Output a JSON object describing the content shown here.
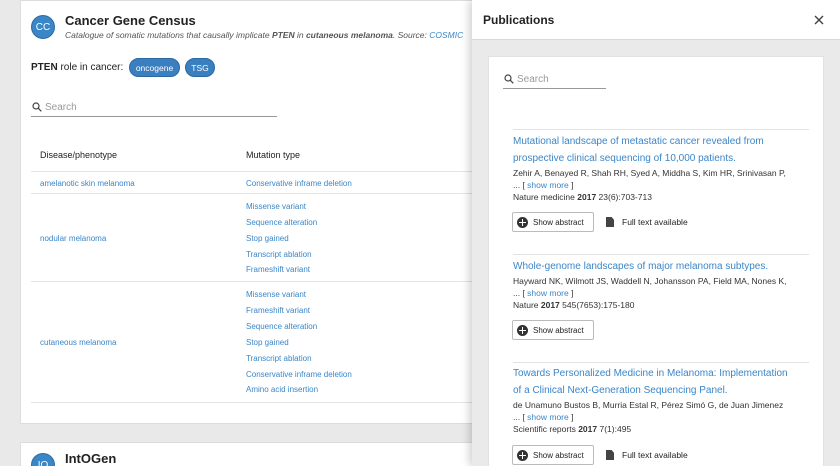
{
  "census": {
    "avatar": "CC",
    "title": "Cancer Gene Census",
    "subtitle_pre": "Catalogue of somatic mutations that causally implicate ",
    "gene": "PTEN",
    "subtitle_mid": " in ",
    "disease": "cutaneous melanoma",
    "subtitle_post": ". Source: ",
    "source": "COSMIC",
    "role_gene": "PTEN",
    "role_label": " role in cancer:",
    "roles": [
      "oncogene",
      "TSG"
    ],
    "search_placeholder": "Search",
    "columns": [
      "Disease/phenotype",
      "Mutation type"
    ],
    "rows": [
      {
        "disease": "amelanotic skin melanoma",
        "mutations": [
          "Conservative inframe deletion"
        ]
      },
      {
        "disease": "nodular melanoma",
        "mutations": [
          "Missense variant",
          "Sequence alteration",
          "Stop gained",
          "Transcript ablation",
          "Frameshift variant"
        ]
      },
      {
        "disease": "cutaneous melanoma",
        "mutations": [
          "Missense variant",
          "Frameshift variant",
          "Sequence alteration",
          "Stop gained",
          "Transcript ablation",
          "Conservative inframe deletion",
          "Amino acid insertion"
        ]
      }
    ]
  },
  "intogen": {
    "avatar": "IO",
    "title": "IntOGen"
  },
  "publications": {
    "title": "Publications",
    "search_placeholder": "Search",
    "show_abstract_label": "Show abstract",
    "full_text_label": "Full text available",
    "items": [
      {
        "title_line1": "Mutational landscape of metastatic cancer revealed from",
        "title_line2": "prospective clinical sequencing of 10,000 patients.",
        "authors": "Zehir A, Benayed R, Shah RH, Syed A, Middha S, Kim HR, Srinivasan P,",
        "more_prefix": "... [ ",
        "more": "show more",
        "more_suffix": " ]",
        "journal": "Nature medicine ",
        "year": "2017",
        "ref": " 23(6):703-713",
        "full_text": true
      },
      {
        "title_line1": "Whole-genome landscapes of major melanoma subtypes.",
        "title_line2": "",
        "authors": "Hayward NK, Wilmott JS, Waddell N, Johansson PA, Field MA, Nones K,",
        "more_prefix": "... [ ",
        "more": "show more",
        "more_suffix": " ]",
        "journal": "Nature ",
        "year": "2017",
        "ref": " 545(7653):175-180",
        "full_text": false
      },
      {
        "title_line1": "Towards Personalized Medicine in Melanoma: Implementation",
        "title_line2": "of a Clinical Next-Generation Sequencing Panel.",
        "authors": "de Unamuno Bustos B, Murria Estal R, Pérez Simó G, de Juan Jimenez",
        "more_prefix": "... [ ",
        "more": "show more",
        "more_suffix": " ]",
        "journal": "Scientific reports ",
        "year": "2017",
        "ref": " 7(1):495",
        "full_text": true
      }
    ]
  },
  "colors": {
    "accent": "#3a86c8",
    "pill": "#3a7fc0"
  }
}
